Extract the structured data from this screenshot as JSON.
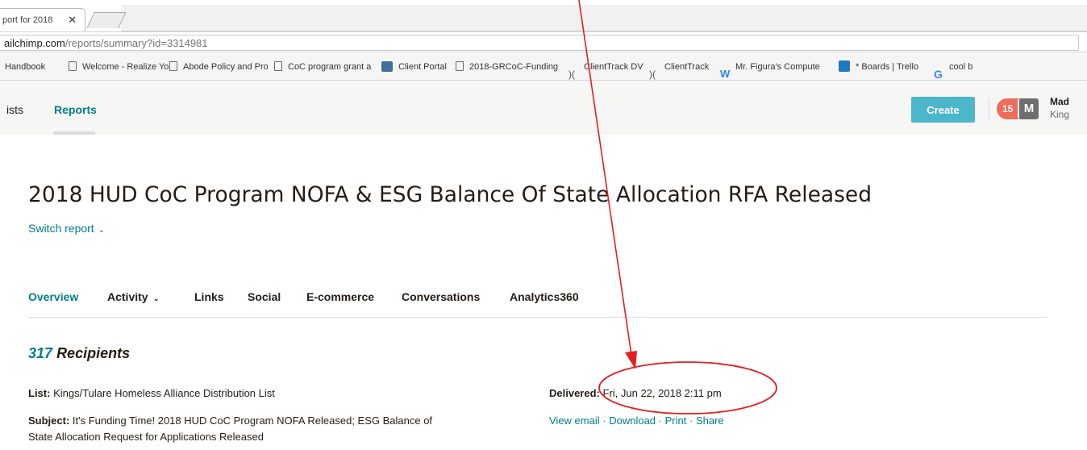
{
  "browser": {
    "tab_title": "port for 2018",
    "tab_close": "✕",
    "url_host": "ailchimp.com",
    "url_path": "/reports/summary?id=3314981",
    "bookmarks": [
      {
        "label": "Handbook",
        "icon": "none"
      },
      {
        "label": "Welcome - Realize Yo",
        "icon": "page-icon"
      },
      {
        "label": "Abode Policy and Pro",
        "icon": "page-icon"
      },
      {
        "label": "CoC program grant a",
        "icon": "page-icon"
      },
      {
        "label": "Client Portal",
        "icon": "portal-icon"
      },
      {
        "label": "2018-GRCoC-Funding",
        "icon": "page-icon"
      },
      {
        "label": "ClientTrack DV",
        "icon": "clienttrack-icon"
      },
      {
        "label": "ClientTrack",
        "icon": "clienttrack-icon"
      },
      {
        "label": "Mr. Figura's Compute",
        "icon": "weebly-icon"
      },
      {
        "label": "* Boards | Trello",
        "icon": "trello-icon"
      },
      {
        "label": "cool b",
        "icon": "google-icon"
      }
    ]
  },
  "header": {
    "nav_lists": "ists",
    "nav_reports": "Reports",
    "create_label": "Create",
    "notification_count": "15",
    "avatar_letter": "M",
    "account_name": "Mad",
    "account_sub": "King"
  },
  "report": {
    "title": "2018 HUD CoC Program NOFA & ESG Balance Of State Allocation RFA Released",
    "switch_label": "Switch report",
    "tabs": [
      "Overview",
      "Activity",
      "Links",
      "Social",
      "E-commerce",
      "Conversations",
      "Analytics360"
    ],
    "recipients_count": "317",
    "recipients_label": "Recipients",
    "list_label": "List:",
    "list_value": "Kings/Tulare Homeless Alliance Distribution List",
    "subject_label": "Subject:",
    "subject_line1": "It's Funding Time!  2018 HUD CoC Program NOFA Released; ESG Balance of",
    "subject_line2": "State Allocation Request for Applications Released",
    "delivered_label": "Delivered:",
    "delivered_value": "Fri, Jun 22, 2018 2:11 pm",
    "links": [
      "View email",
      "Download",
      "Print",
      "Share"
    ],
    "link_separator": "·"
  },
  "annotation": {
    "color": "#e41e1e"
  }
}
